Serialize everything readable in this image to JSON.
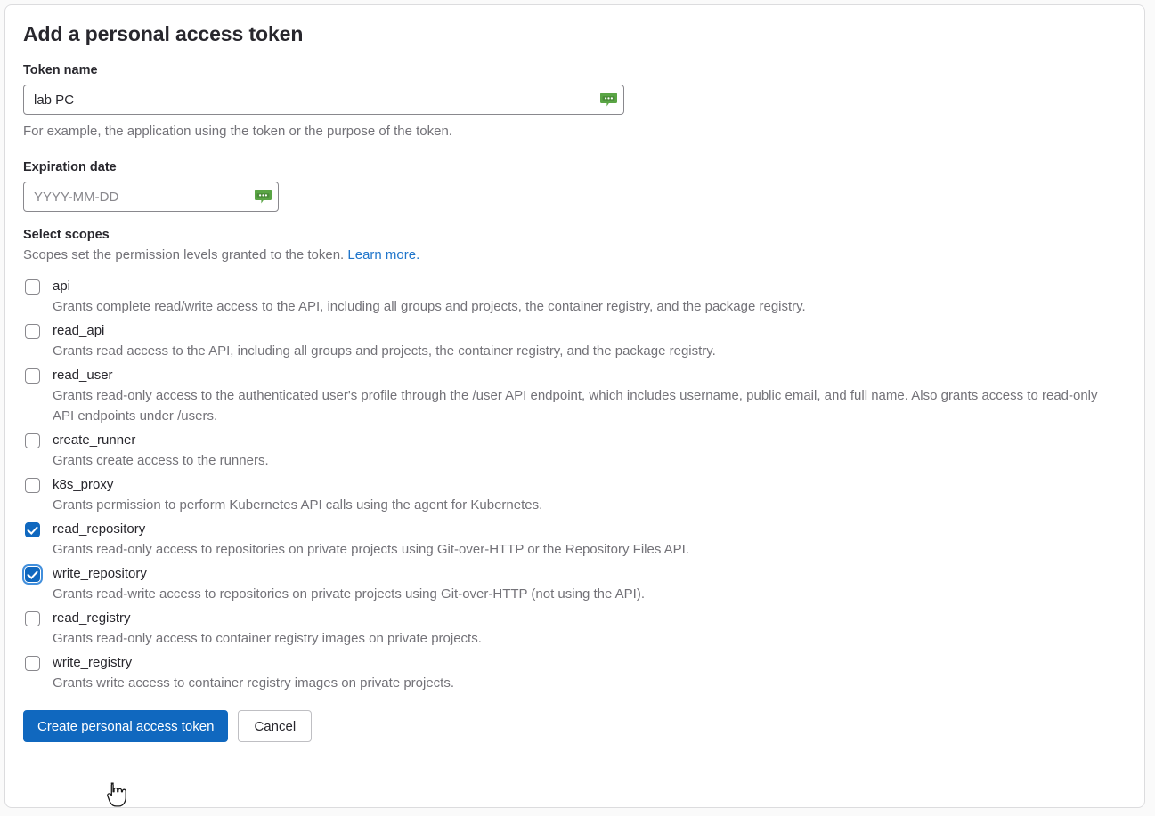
{
  "page": {
    "title": "Add a personal access token"
  },
  "token_name": {
    "label": "Token name",
    "value": "lab PC",
    "placeholder": "",
    "help": "For example, the application using the token or the purpose of the token.",
    "autofill_icon": "autofill-bubble-icon"
  },
  "expiration": {
    "label": "Expiration date",
    "value": "",
    "placeholder": "YYYY-MM-DD",
    "autofill_icon": "autofill-bubble-icon"
  },
  "scopes": {
    "heading": "Select scopes",
    "subtext": "Scopes set the permission levels granted to the token.",
    "learn_more": "Learn more.",
    "items": [
      {
        "name": "api",
        "description": "Grants complete read/write access to the API, including all groups and projects, the container registry, and the package registry.",
        "checked": false,
        "focused": false
      },
      {
        "name": "read_api",
        "description": "Grants read access to the API, including all groups and projects, the container registry, and the package registry.",
        "checked": false,
        "focused": false
      },
      {
        "name": "read_user",
        "description": "Grants read-only access to the authenticated user's profile through the /user API endpoint, which includes username, public email, and full name. Also grants access to read-only API endpoints under /users.",
        "checked": false,
        "focused": false
      },
      {
        "name": "create_runner",
        "description": "Grants create access to the runners.",
        "checked": false,
        "focused": false
      },
      {
        "name": "k8s_proxy",
        "description": "Grants permission to perform Kubernetes API calls using the agent for Kubernetes.",
        "checked": false,
        "focused": false
      },
      {
        "name": "read_repository",
        "description": "Grants read-only access to repositories on private projects using Git-over-HTTP or the Repository Files API.",
        "checked": true,
        "focused": false
      },
      {
        "name": "write_repository",
        "description": "Grants read-write access to repositories on private projects using Git-over-HTTP (not using the API).",
        "checked": true,
        "focused": true
      },
      {
        "name": "read_registry",
        "description": "Grants read-only access to container registry images on private projects.",
        "checked": false,
        "focused": false
      },
      {
        "name": "write_registry",
        "description": "Grants write access to container registry images on private projects.",
        "checked": false,
        "focused": false
      }
    ]
  },
  "actions": {
    "submit_label": "Create personal access token",
    "cancel_label": "Cancel"
  },
  "colors": {
    "primary": "#1068bf",
    "link": "#1f75cb",
    "text": "#28272d",
    "muted": "#737278",
    "autofill_green": "#5aa545",
    "focus_ring": "#428fdc"
  },
  "cursor": {
    "icon": "pointer-hand-cursor"
  }
}
